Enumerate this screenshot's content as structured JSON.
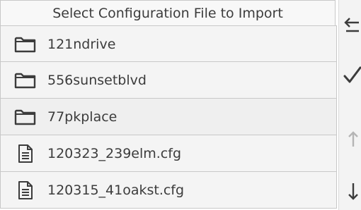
{
  "dialog": {
    "title": "Select Configuration File to Import"
  },
  "files": [
    {
      "name": "121ndrive",
      "type": "folder",
      "icon": "folder-icon"
    },
    {
      "name": "556sunsetblvd",
      "type": "folder",
      "icon": "folder-icon"
    },
    {
      "name": "77pkplace",
      "type": "folder",
      "icon": "folder-icon"
    },
    {
      "name": "120323_239elm.cfg",
      "type": "file",
      "icon": "document-icon"
    },
    {
      "name": "120315_41oakst.cfg",
      "type": "file",
      "icon": "document-icon"
    }
  ],
  "sidebar": {
    "back_icon": "back-arrow-icon",
    "confirm_icon": "checkmark-icon",
    "up_icon": "arrow-up-icon",
    "down_icon": "arrow-down-icon"
  },
  "colors": {
    "text": "#3c3c3c",
    "row_bg": "#f4f4f4",
    "border": "#c8c8c8",
    "disabled": "#b5b5b5"
  }
}
